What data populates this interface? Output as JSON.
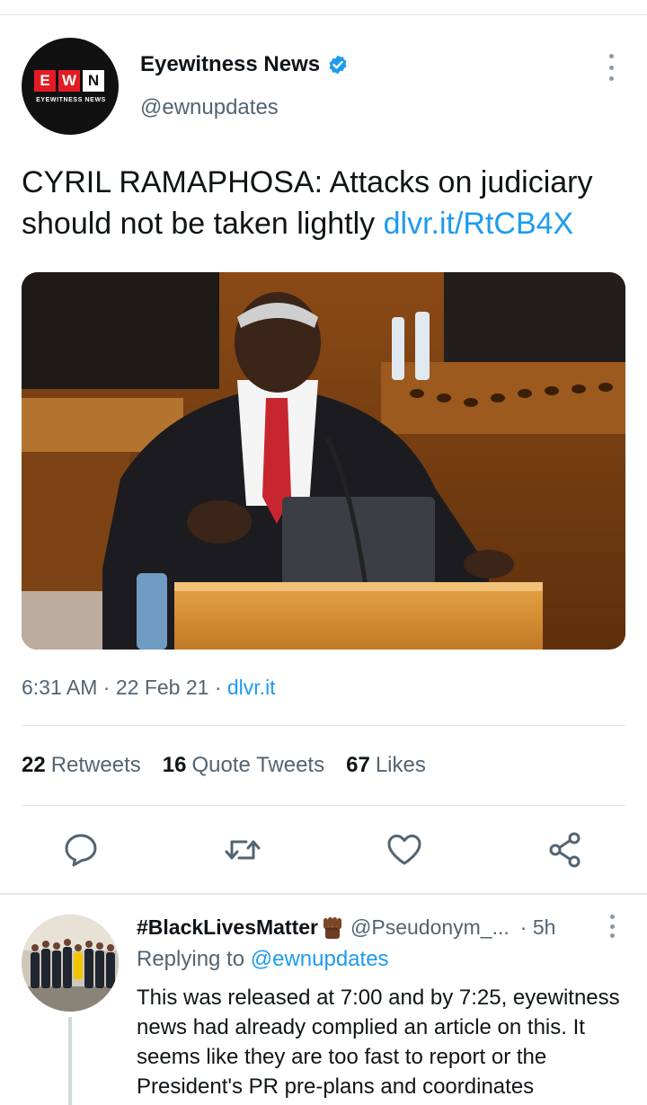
{
  "tweet": {
    "author": {
      "display_name": "Eyewitness News",
      "handle": "@ewnupdates",
      "verified": true,
      "avatar_logo_letters": [
        "E",
        "W",
        "N"
      ],
      "avatar_subtitle": "EYEWITNESS NEWS"
    },
    "text": "CYRIL RAMAPHOSA: Attacks on judiciary should not be taken lightly ",
    "link": "dlvr.it/RtCB4X",
    "time": "6:31 AM",
    "date": "22 Feb 21",
    "source": "dlvr.it",
    "stats": {
      "retweets_count": "22",
      "retweets_label": "Retweets",
      "quotes_count": "16",
      "quotes_label": "Quote Tweets",
      "likes_count": "67",
      "likes_label": "Likes"
    }
  },
  "reply": {
    "display_name": "#BlackLivesMatter",
    "handle": "@Pseudonym_...",
    "time": "5h",
    "replying_prefix": "Replying to ",
    "replying_to": "@ewnupdates",
    "text": "This was released at 7:00 and by 7:25, eyewitness news had already complied an article on this. It seems like they are too fast to report or the President's PR pre-plans and coordinates"
  },
  "colors": {
    "accent": "#1d9bf0",
    "secondary_text": "#536471",
    "primary_text": "#0f1419",
    "divider": "#e1e6ea"
  },
  "icons": {
    "verified": "verified-badge-icon",
    "reply": "reply-icon",
    "retweet": "retweet-icon",
    "like": "heart-icon",
    "share": "share-icon",
    "more": "more-vertical-icon",
    "emoji": "raised-fist-emoji"
  }
}
